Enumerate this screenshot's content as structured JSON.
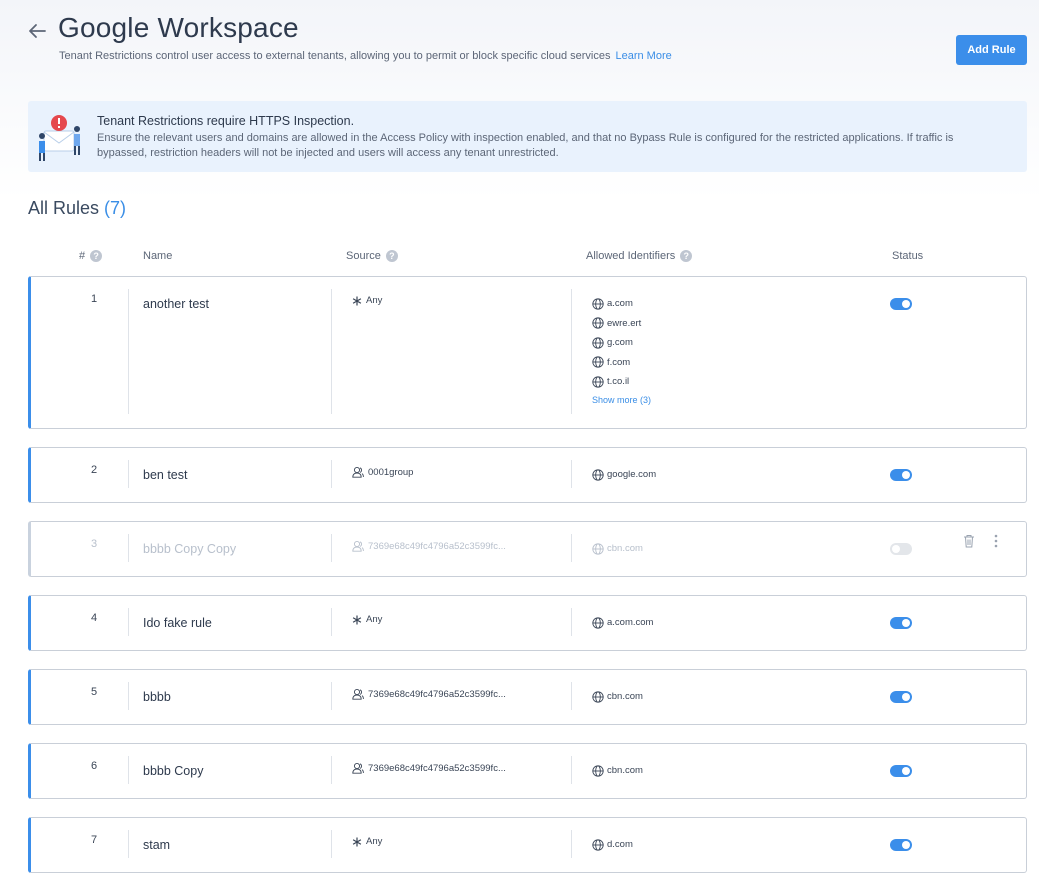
{
  "header": {
    "title": "Google Workspace",
    "subtitle": "Tenant Restrictions control user access to external tenants, allowing you to permit or block specific cloud services",
    "learn_more": "Learn More",
    "add_rule_label": "Add Rule"
  },
  "banner": {
    "title": "Tenant Restrictions require HTTPS Inspection.",
    "text": "Ensure the relevant users and domains are allowed in the Access Policy with inspection enabled, and that no Bypass Rule is configured for the restricted applications. If traffic is bypassed, restriction headers will not be injected and users will access any tenant unrestricted."
  },
  "rules_section": {
    "title": "All Rules",
    "count": "(7)"
  },
  "columns": {
    "num": "#",
    "name": "Name",
    "source": "Source",
    "allowed": "Allowed Identifiers",
    "status": "Status"
  },
  "colors": {
    "accent": "#3b8eea",
    "banner_bg": "#e9f2fd",
    "alert_red": "#e5484d"
  },
  "rules": [
    {
      "num": "1",
      "name": "another test",
      "source": "Any",
      "source_icon": "asterisk-icon",
      "identifiers": [
        "a.com",
        "ewre.ert",
        "g.com",
        "f.com",
        "t.co.il"
      ],
      "show_more": "Show more (3)",
      "enabled": true
    },
    {
      "num": "2",
      "name": "ben test",
      "source": "0001group",
      "source_icon": "user-group-icon",
      "identifiers": [
        "google.com"
      ],
      "enabled": true
    },
    {
      "num": "3",
      "name": "bbbb Copy Copy",
      "source": "7369e68c49fc4796a52c3599fc...",
      "source_icon": "user-group-icon",
      "identifiers": [
        "cbn.com"
      ],
      "enabled": false
    },
    {
      "num": "4",
      "name": "Ido fake rule",
      "source": "Any",
      "source_icon": "asterisk-icon",
      "identifiers": [
        "a.com.com"
      ],
      "enabled": true
    },
    {
      "num": "5",
      "name": "bbbb",
      "source": "7369e68c49fc4796a52c3599fc...",
      "source_icon": "user-group-icon",
      "identifiers": [
        "cbn.com"
      ],
      "enabled": true
    },
    {
      "num": "6",
      "name": "bbbb Copy",
      "source": "7369e68c49fc4796a52c3599fc...",
      "source_icon": "user-group-icon",
      "identifiers": [
        "cbn.com"
      ],
      "enabled": true
    },
    {
      "num": "7",
      "name": "stam",
      "source": "Any",
      "source_icon": "asterisk-icon",
      "identifiers": [
        "d.com"
      ],
      "enabled": true
    }
  ]
}
